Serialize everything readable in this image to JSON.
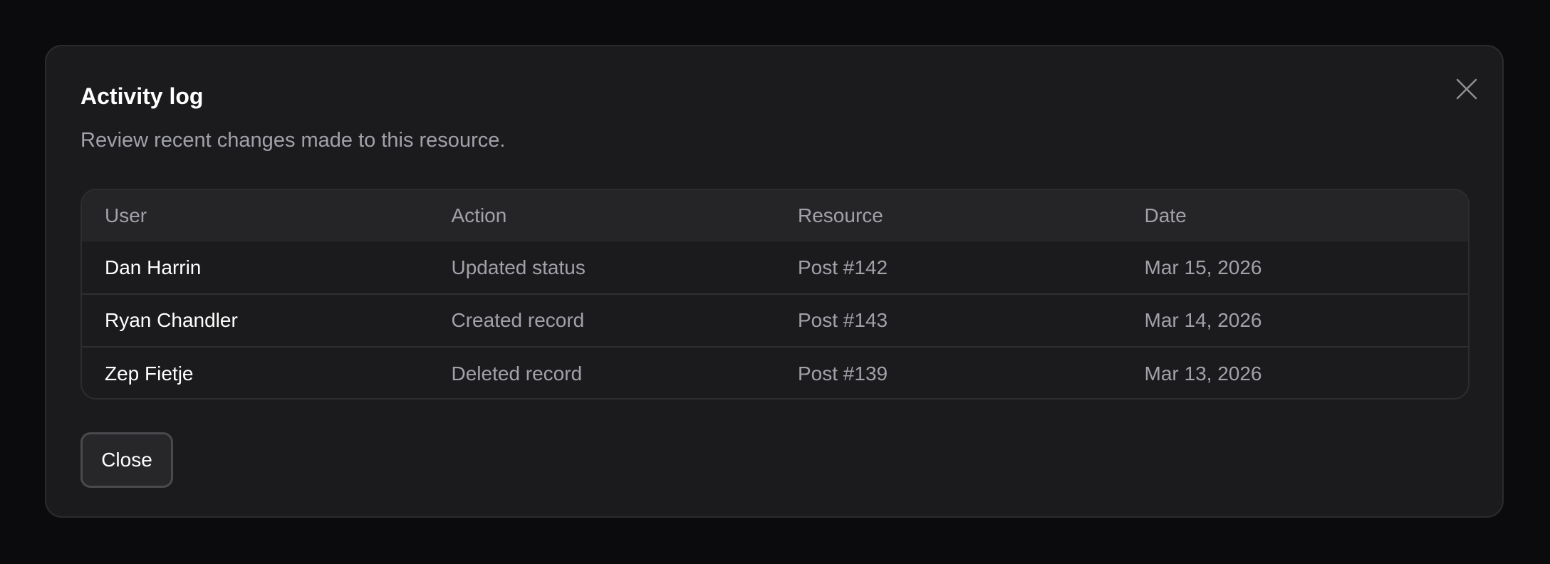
{
  "modal": {
    "title": "Activity log",
    "description": "Review recent changes made to this resource.",
    "close_icon": "close-icon",
    "close_button_label": "Close"
  },
  "table": {
    "headers": [
      "User",
      "Action",
      "Resource",
      "Date"
    ],
    "rows": [
      {
        "user": "Dan Harrin",
        "action": "Updated status",
        "resource": "Post #142",
        "date": "Mar 15, 2026"
      },
      {
        "user": "Ryan Chandler",
        "action": "Created record",
        "resource": "Post #143",
        "date": "Mar 14, 2026"
      },
      {
        "user": "Zep Fietje",
        "action": "Deleted record",
        "resource": "Post #139",
        "date": "Mar 13, 2026"
      }
    ]
  },
  "colors": {
    "backdrop": "#0b0b0d",
    "modal_bg": "#1b1b1d",
    "header_row_bg": "#252527",
    "primary_text": "#ffffff",
    "muted_text": "#a1a1aa"
  }
}
